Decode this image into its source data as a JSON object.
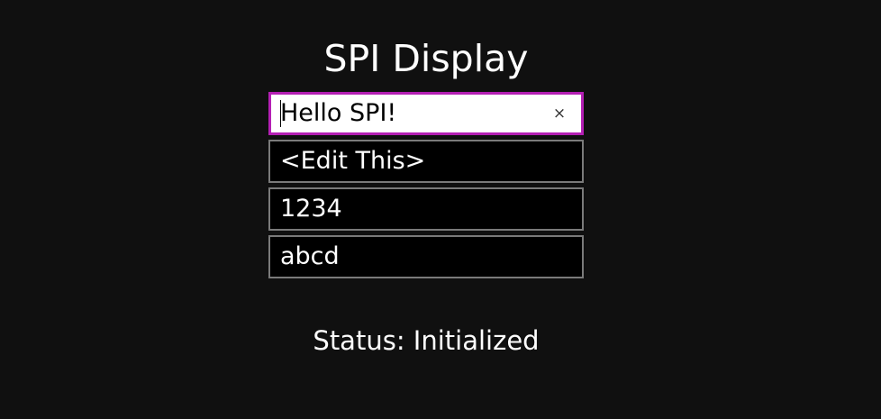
{
  "page": {
    "title": "SPI Display",
    "status": "Status: Initialized"
  },
  "fields": [
    {
      "value": "Hello SPI!",
      "focused": true,
      "clear_icon": "×"
    },
    {
      "value": "<Edit This>",
      "focused": false
    },
    {
      "value": "1234",
      "focused": false
    },
    {
      "value": "abcd",
      "focused": false
    }
  ],
  "colors": {
    "background": "#101010",
    "focus_border": "#b41fb4",
    "field_border": "#7a7a7a"
  }
}
